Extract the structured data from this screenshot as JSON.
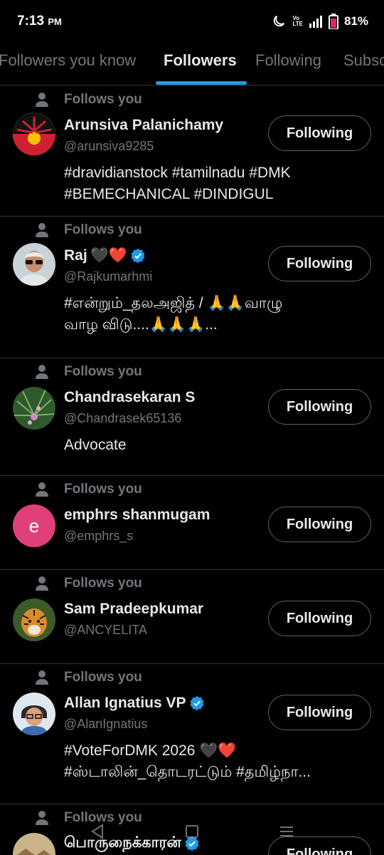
{
  "status_bar": {
    "time": "7:13",
    "ampm": "PM",
    "net_line1": "Vo",
    "net_line2": "LTE",
    "battery": "81%"
  },
  "tabs": [
    {
      "label": "Followers you know",
      "active": false
    },
    {
      "label": "Followers",
      "active": true
    },
    {
      "label": "Following",
      "active": false
    },
    {
      "label": "Subscriptions",
      "active": false
    }
  ],
  "follows_you_label": "Follows you",
  "follow_button_label": "Following",
  "users": [
    {
      "name": "Arunsiva Palanichamy",
      "emoji": "",
      "verified": false,
      "handle": "@arunsiva9285",
      "bio": "#dravidianstock #tamilnadu #DMK\n#BEMECHANICAL #DINDIGUL",
      "avatar": "dmk-logo"
    },
    {
      "name": "Raj",
      "emoji": "🖤❤️",
      "verified": true,
      "handle": "@Rajkumarhmi",
      "bio": "#என்றும்_தலஅஜித் / 🙏🙏வாழு\nவாழ விடு....🙏🙏🙏...",
      "avatar": "photo"
    },
    {
      "name": "Chandrasekaran S",
      "emoji": "",
      "verified": false,
      "handle": "@Chandrasek65136",
      "bio": "Advocate",
      "avatar": "flower"
    },
    {
      "name": "emphrs shanmugam",
      "emoji": "",
      "verified": false,
      "handle": "@emphrs_s",
      "bio": "",
      "avatar": "letter",
      "avatar_letter": "e",
      "avatar_color": "#e0407a"
    },
    {
      "name": "Sam Pradeepkumar",
      "emoji": "",
      "verified": false,
      "handle": "@ANCYELITA",
      "bio": "",
      "avatar": "tiger"
    },
    {
      "name": "Allan Ignatius VP",
      "emoji": "",
      "verified": true,
      "handle": "@AlanIgnatius",
      "bio": "#VoteForDMK 2026 🖤❤️\n#ஸ்டாலின்_தொடரட்டும் #தமிழ்நா...",
      "avatar": "cartoon"
    },
    {
      "name": "பொருநைக்காரன்",
      "emoji": "",
      "verified": true,
      "handle": "",
      "bio": "",
      "avatar": "landscape"
    }
  ],
  "colors": {
    "accent": "#1d9bf0",
    "muted": "#71767b",
    "divider": "#2f3336"
  },
  "icons": {
    "follows_you": "person-icon",
    "verified": "verified-badge-icon",
    "nav_back": "back-triangle-icon",
    "nav_home": "home-square-icon",
    "nav_menu": "menu-lines-icon"
  }
}
